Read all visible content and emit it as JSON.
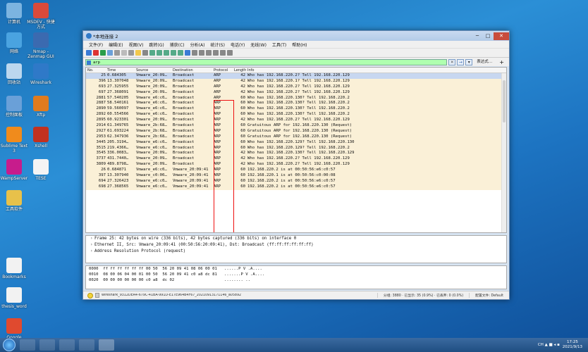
{
  "desktop_icons": [
    {
      "label": "计算机",
      "color": "#7cb4e0"
    },
    {
      "label": "MSDEV - 快捷方式",
      "color": "#d94a3a"
    },
    {
      "label": "网络",
      "color": "#4aa3e0"
    },
    {
      "label": "Nmap - Zenmap GUI",
      "color": "#3b6ab0"
    },
    {
      "label": "回收站",
      "color": "#bcd7ee"
    },
    {
      "label": "Wireshark",
      "color": "#2f79c8"
    },
    {
      "label": "控制面板",
      "color": "#6aa0d8"
    },
    {
      "label": "Xftp",
      "color": "#e07b1e"
    },
    {
      "label": "Sublime Text 3",
      "color": "#f08b1c"
    },
    {
      "label": "Xshell",
      "color": "#c2311f"
    },
    {
      "label": "WampServer",
      "color": "#c71c8c"
    },
    {
      "label": "TESE",
      "color": "#f4f4f4"
    },
    {
      "label": "工具软件",
      "color": "#e8c14a"
    },
    {
      "label": "Bookmarks",
      "color": "#f2f2f2"
    },
    {
      "label": "thesis_word",
      "color": "#f2f2f2"
    },
    {
      "label": "Google Chrome",
      "color": "#e04a2f"
    }
  ],
  "window": {
    "title": "*本地连接 2",
    "minimize": "─",
    "maximize": "□",
    "close": "✕"
  },
  "menu": [
    "文件(F)",
    "编辑(E)",
    "视图(V)",
    "跳转(G)",
    "捕获(C)",
    "分析(A)",
    "统计(S)",
    "电话(Y)",
    "无线(W)",
    "工具(T)",
    "帮助(H)"
  ],
  "filter": {
    "value": "arp",
    "clear": "✕",
    "apply": "→",
    "dropdown": "▾",
    "expression": "表达式…",
    "add": "+"
  },
  "columns": {
    "no": "No.",
    "time": "Time",
    "source": "Source",
    "destination": "Destination",
    "protocol": "Protocol",
    "length": "Length",
    "info": "Info"
  },
  "packets": [
    {
      "no": "25",
      "time": "0.684305",
      "src": "Vmware_20:09…",
      "dst": "Broadcast",
      "proto": "ARP",
      "len": "42",
      "info": "Who has 192.168.220.2? Tell 192.168.220.129"
    },
    {
      "no": "396",
      "time": "13.307048",
      "src": "Vmware_20:09…",
      "dst": "Broadcast",
      "proto": "ARP",
      "len": "42",
      "info": "Who has 192.168.220.1? Tell 192.168.220.129"
    },
    {
      "no": "693",
      "time": "27.325955",
      "src": "Vmware_20:09…",
      "dst": "Broadcast",
      "proto": "ARP",
      "len": "42",
      "info": "Who has 192.168.220.2? Tell 192.168.220.129"
    },
    {
      "no": "697",
      "time": "27.368091",
      "src": "Vmware_20:09…",
      "dst": "Broadcast",
      "proto": "ARP",
      "len": "42",
      "info": "Who has 192.168.220.2? Tell 192.168.220.129"
    },
    {
      "no": "2881",
      "time": "57.540205",
      "src": "Vmware_e6:c0…",
      "dst": "Broadcast",
      "proto": "ARP",
      "len": "60",
      "info": "Who has 192.168.220.130? Tell 192.168.220.2"
    },
    {
      "no": "2887",
      "time": "58.540161",
      "src": "Vmware_e6:c0…",
      "dst": "Broadcast",
      "proto": "ARP",
      "len": "60",
      "info": "Who has 192.168.220.130? Tell 192.168.220.2"
    },
    {
      "no": "2890",
      "time": "59.560097",
      "src": "Vmware_e6:c0…",
      "dst": "Broadcast",
      "proto": "ARP",
      "len": "60",
      "info": "Who has 192.168.220.130? Tell 192.168.220.2"
    },
    {
      "no": "2892",
      "time": "60.554566",
      "src": "Vmware_e6:c0…",
      "dst": "Broadcast",
      "proto": "ARP",
      "len": "60",
      "info": "Who has 192.168.220.130? Tell 192.168.220.2"
    },
    {
      "no": "2895",
      "time": "60.923301",
      "src": "Vmware_20:09…",
      "dst": "Broadcast",
      "proto": "ARP",
      "len": "42",
      "info": "Who has 192.168.220.2? Tell 192.168.220.129"
    },
    {
      "no": "2914",
      "time": "61.349765",
      "src": "Vmware_2b:68…",
      "dst": "Broadcast",
      "proto": "ARP",
      "len": "60",
      "info": "Gratuitous ARP for 192.168.220.130 (Request)"
    },
    {
      "no": "2927",
      "time": "61.693224",
      "src": "Vmware_2b:68…",
      "dst": "Broadcast",
      "proto": "ARP",
      "len": "60",
      "info": "Gratuitous ARP for 192.168.220.130 (Request)"
    },
    {
      "no": "2953",
      "time": "62.347936",
      "src": "Vmware_2b:68…",
      "dst": "Broadcast",
      "proto": "ARP",
      "len": "60",
      "info": "Gratuitous ARP for 192.168.220.130 (Request)"
    },
    {
      "no": "3445",
      "time": "205.3194…",
      "src": "Vmware_e6:c0…",
      "dst": "Broadcast",
      "proto": "ARP",
      "len": "60",
      "info": "Who has 192.168.220.129? Tell 192.168.220.130"
    },
    {
      "no": "3515",
      "time": "219.4366…",
      "src": "Vmware_e6:c0…",
      "dst": "Broadcast",
      "proto": "ARP",
      "len": "60",
      "info": "Who has 192.168.220.129? Tell 192.168.220.2"
    },
    {
      "no": "3545",
      "time": "336.0083…",
      "src": "Vmware_20:09…",
      "dst": "Broadcast",
      "proto": "ARP",
      "len": "42",
      "info": "Who has 192.168.220.130? Tell 192.168.220.129"
    },
    {
      "no": "3737",
      "time": "431.7440…",
      "src": "Vmware_20:09…",
      "dst": "Broadcast",
      "proto": "ARP",
      "len": "42",
      "info": "Who has 192.168.220.2? Tell 192.168.220.129"
    },
    {
      "no": "3809",
      "time": "489.8798…",
      "src": "Vmware_20:09…",
      "dst": "Broadcast",
      "proto": "ARP",
      "len": "42",
      "info": "Who has 192.168.220.2? Tell 192.168.220.129"
    },
    {
      "no": "26",
      "time": "0.684871",
      "src": "Vmware_e6:c0…",
      "dst": "Vmware_20:09:41",
      "proto": "ARP",
      "len": "60",
      "info": "192.168.220.2 is at 00:50:56:e6:c0:57"
    },
    {
      "no": "397",
      "time": "13.307940",
      "src": "Vmware_c0:00…",
      "dst": "Vmware_20:09:41",
      "proto": "ARP",
      "len": "60",
      "info": "192.168.220.1 is at 00:50:56:c0:00:08"
    },
    {
      "no": "694",
      "time": "27.326423",
      "src": "Vmware_e6:c0…",
      "dst": "Vmware_20:09:41",
      "proto": "ARP",
      "len": "60",
      "info": "192.168.220.2 is at 00:50:56:e6:c0:57"
    },
    {
      "no": "698",
      "time": "27.368565",
      "src": "Vmware_e6:c0…",
      "dst": "Vmware_20:09:41",
      "proto": "ARP",
      "len": "60",
      "info": "192.168.220.2 is at 00:50:56:e6:c0:57"
    }
  ],
  "details": [
    "Frame 25: 42 bytes on wire (336 bits), 42 bytes captured (336 bits) on interface 0",
    "Ethernet II, Src: Vmware_20:09:41 (00:50:56:20:09:41), Dst: Broadcast (ff:ff:ff:ff:ff:ff)",
    "Address Resolution Protocol (request)"
  ],
  "bytes": [
    "0000  ff ff ff ff ff ff 00 50  56 20 09 41 08 06 00 01   ......P V .A....",
    "0010  08 00 06 04 00 01 00 50  56 20 09 41 c0 a8 dc 81   .......P V .A....",
    "0020  00 00 00 00 00 00 c0 a8  dc 02                     ........ .."
  ],
  "status": {
    "file": "wireshark_9312DEA4-679C-41BA-991D-E17E964B4F67_20210913171146_a05892",
    "packets": "分组: 3880 · 已显示: 35 (0.9%) · 已丢弃: 0 (0.0%)",
    "profile": "配置文件: Default"
  },
  "taskbar": {
    "time": "17:25",
    "date": "2021/9/13",
    "tray_text": "CH ▲ ■ ◂ ▪"
  }
}
